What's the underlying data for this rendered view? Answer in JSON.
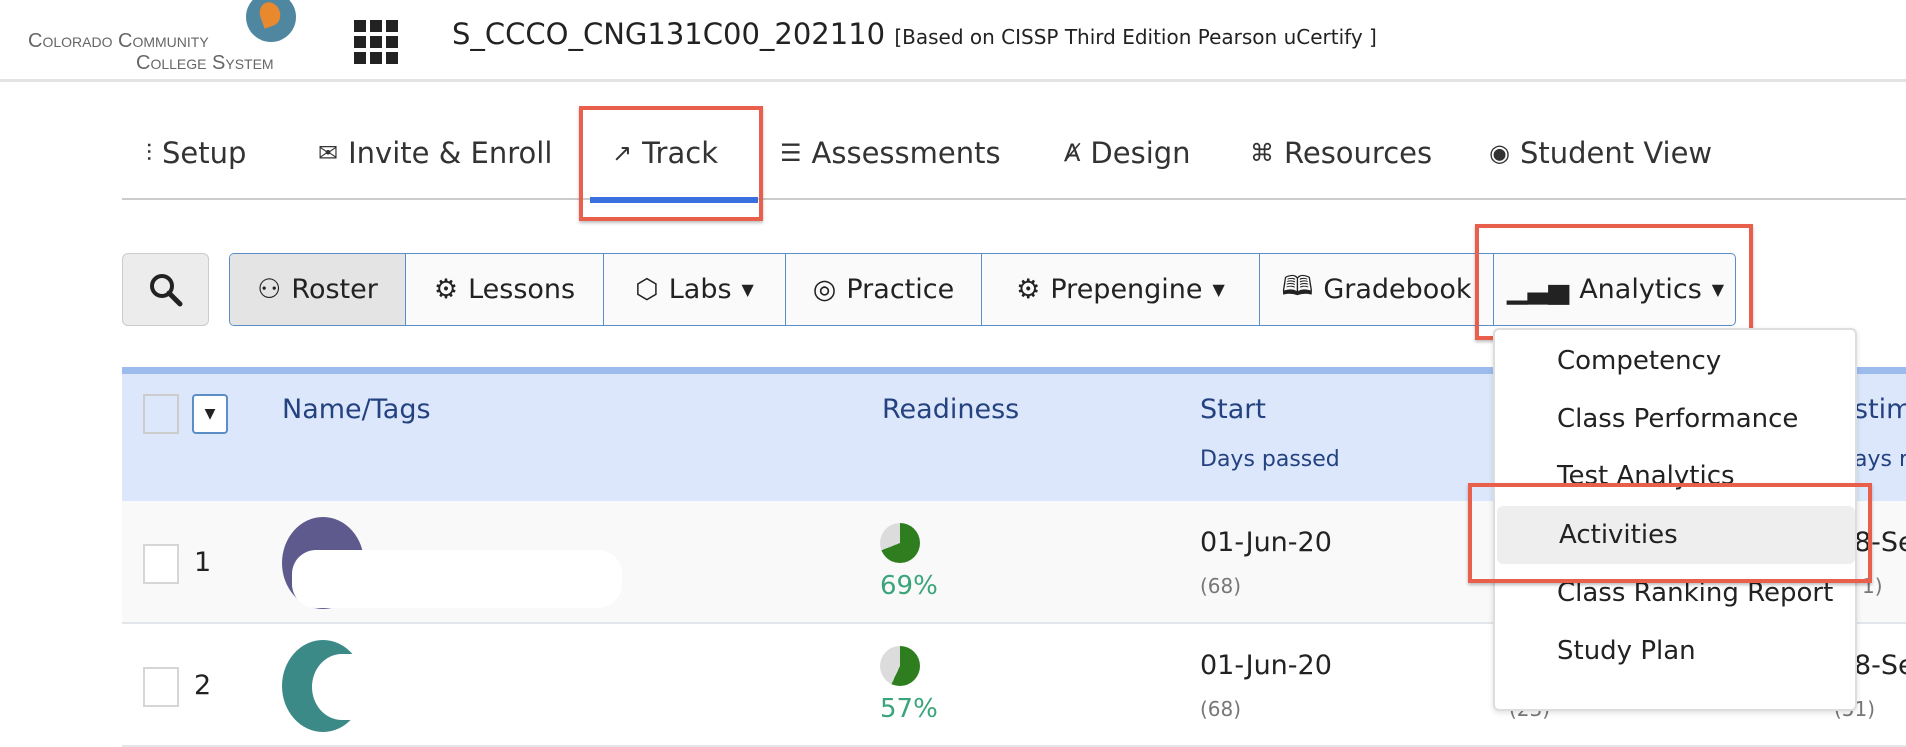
{
  "header": {
    "logo_text_line1": "Colorado Community",
    "logo_text_line2": "College System",
    "course_title": "S_CCCO_CNG131C00_202110",
    "course_subtitle": "[Based on CISSP Third Edition Pearson uCertify ]"
  },
  "nav_tabs": [
    {
      "label": "Setup",
      "icon": "sliders-icon"
    },
    {
      "label": "Invite & Enroll",
      "icon": "envelope-icon"
    },
    {
      "label": "Track",
      "icon": "chart-line-icon",
      "active": true
    },
    {
      "label": "Assessments",
      "icon": "checklist-icon"
    },
    {
      "label": "Design",
      "icon": "compass-icon"
    },
    {
      "label": "Resources",
      "icon": "cubes-icon"
    },
    {
      "label": "Student View",
      "icon": "eye-icon"
    }
  ],
  "toolbar": {
    "buttons": [
      {
        "label": "Roster",
        "icon": "user-icon",
        "active": true
      },
      {
        "label": "Lessons",
        "icon": "gear-icon"
      },
      {
        "label": "Labs",
        "icon": "cube-icon",
        "dropdown": true
      },
      {
        "label": "Practice",
        "icon": "target-icon"
      },
      {
        "label": "Prepengine",
        "icon": "gears-icon",
        "dropdown": true
      },
      {
        "label": "Gradebook",
        "icon": "book-icon"
      },
      {
        "label": "Analytics",
        "icon": "bar-chart-icon",
        "dropdown": true
      }
    ]
  },
  "table": {
    "columns": {
      "name": "Name/Tags",
      "readiness": "Readiness",
      "start": "Start",
      "start_sub": "Days passed",
      "estimated_partial": "stim",
      "estimated_sub_partial": "ays r"
    },
    "rows": [
      {
        "num": "1",
        "readiness": 69,
        "readiness_label": "69%",
        "start": "01-Jun-20",
        "days_passed": "(68)",
        "end_partial": "8-Se",
        "end_days_partial": "1)",
        "avatar_color": "#5e5a8e"
      },
      {
        "num": "2",
        "readiness": 57,
        "readiness_label": "57%",
        "start": "01-Jun-20",
        "days_passed": "(68)",
        "hidden_days": "(23)",
        "end_partial": "8-Se",
        "end_days_partial": "(51)",
        "avatar_color": "#3b8a88"
      }
    ]
  },
  "analytics_menu": {
    "items": [
      "Competency",
      "Class Performance",
      "Test Analytics",
      "Activities",
      "Class Ranking Report",
      "Study Plan"
    ],
    "highlighted": "Activities"
  },
  "colors": {
    "accent": "#3b6fe0",
    "highlight_box": "#e8604c",
    "table_header": "#dce7fb",
    "readiness_green": "#2e7d1f",
    "percent_text": "#3aa57a"
  }
}
